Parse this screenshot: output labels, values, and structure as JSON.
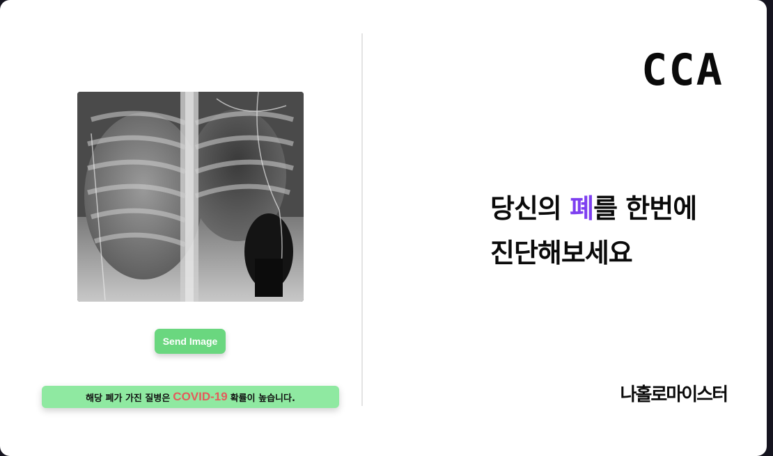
{
  "left_panel": {
    "xray_image": {
      "icon": "chest-xray-image"
    },
    "send_button_label": "Send Image",
    "result": {
      "prefix": "해당 폐가 가진 질병은",
      "disease": "COVID-19",
      "suffix": "확률이 높습니다."
    }
  },
  "right_panel": {
    "logo": "CCA",
    "headline": {
      "part1": "당신의 ",
      "highlight": "폐",
      "part2": "를 한번에",
      "line2": "진단해보세요"
    },
    "brand": "나홀로마이스터"
  },
  "colors": {
    "accent_purple": "#7d3ff0",
    "button_green": "#6ad77f",
    "result_green": "#8fe9a1",
    "disease_red": "#e45b5b"
  }
}
